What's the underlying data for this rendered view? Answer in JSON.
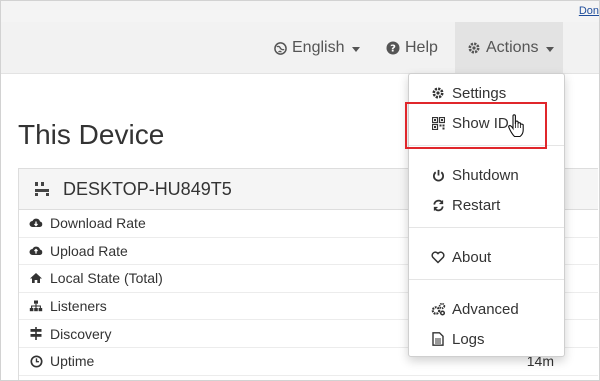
{
  "top_link": "Don",
  "nav": {
    "language": "English",
    "help": "Help",
    "actions": "Actions"
  },
  "page_title": "This Device",
  "device": {
    "name": "DESKTOP-HU849T5",
    "rows": [
      {
        "label": "Download Rate",
        "icon": "cloud-download-icon",
        "value": ""
      },
      {
        "label": "Upload Rate",
        "icon": "cloud-upload-icon",
        "value": ""
      },
      {
        "label": "Local State (Total)",
        "icon": "home-icon",
        "value": ""
      },
      {
        "label": "Listeners",
        "icon": "sitemap-icon",
        "value": ""
      },
      {
        "label": "Discovery",
        "icon": "signpost-icon",
        "value": ""
      },
      {
        "label": "Uptime",
        "icon": "clock-icon",
        "value": "14m"
      }
    ]
  },
  "menu": {
    "settings": "Settings",
    "show_id": "Show ID",
    "shutdown": "Shutdown",
    "restart": "Restart",
    "about": "About",
    "advanced": "Advanced",
    "logs": "Logs"
  },
  "colors": {
    "highlight": "#e0262b",
    "navbar": "#f2f2f2",
    "link": "#1f4d9b"
  }
}
